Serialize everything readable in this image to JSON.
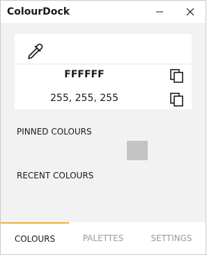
{
  "window": {
    "title": "ColourDock",
    "icons": {
      "minimize": "minimize-icon",
      "close": "close-icon"
    }
  },
  "picker": {
    "icon": "eyedropper-icon",
    "hex": "FFFFFF",
    "rgb": "255, 255, 255",
    "copy_icon": "copy-icon"
  },
  "sections": {
    "pinned_label": "PINNED COLOURS",
    "recent_label": "RECENT COLOURS",
    "pinned_swatches": [
      "#C4C4C4"
    ]
  },
  "tabs": [
    {
      "label": "COLOURS",
      "active": true
    },
    {
      "label": "PALETTES",
      "active": false
    },
    {
      "label": "SETTINGS",
      "active": false
    }
  ],
  "colors": {
    "accent": "#E8B23C",
    "background": "#F2F2F2",
    "inactive_tab_text": "#9A9A9A"
  }
}
